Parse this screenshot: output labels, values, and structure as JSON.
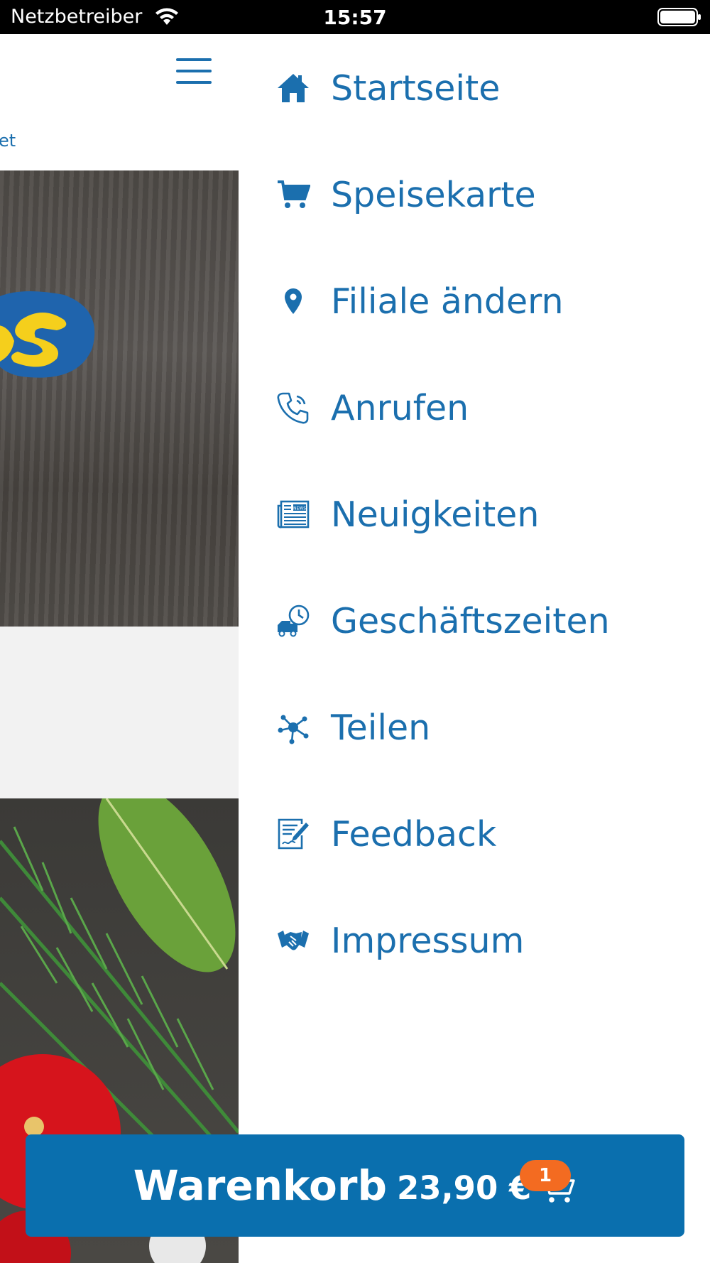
{
  "status_bar": {
    "carrier": "Netzbetreiber",
    "time": "15:57"
  },
  "page": {
    "breadcrumb_fragment": "et"
  },
  "menu": {
    "items": [
      {
        "label": "Startseite",
        "icon": "home-icon"
      },
      {
        "label": "Speisekarte",
        "icon": "cart-icon"
      },
      {
        "label": "Filiale ändern",
        "icon": "location-pin-icon"
      },
      {
        "label": "Anrufen",
        "icon": "phone-icon"
      },
      {
        "label": "Neuigkeiten",
        "icon": "newspaper-icon"
      },
      {
        "label": "Geschäftszeiten",
        "icon": "delivery-clock-icon"
      },
      {
        "label": "Teilen",
        "icon": "share-icon"
      },
      {
        "label": "Feedback",
        "icon": "feedback-icon"
      },
      {
        "label": "Impressum",
        "icon": "handshake-icon"
      }
    ],
    "news_icon_text": "NEWS"
  },
  "cart": {
    "title": "Warenkorb",
    "price": "23,90 €",
    "count": "1"
  },
  "colors": {
    "accent": "#1b6fae",
    "cart_bg": "#0a6fae",
    "badge": "#f36b21"
  }
}
